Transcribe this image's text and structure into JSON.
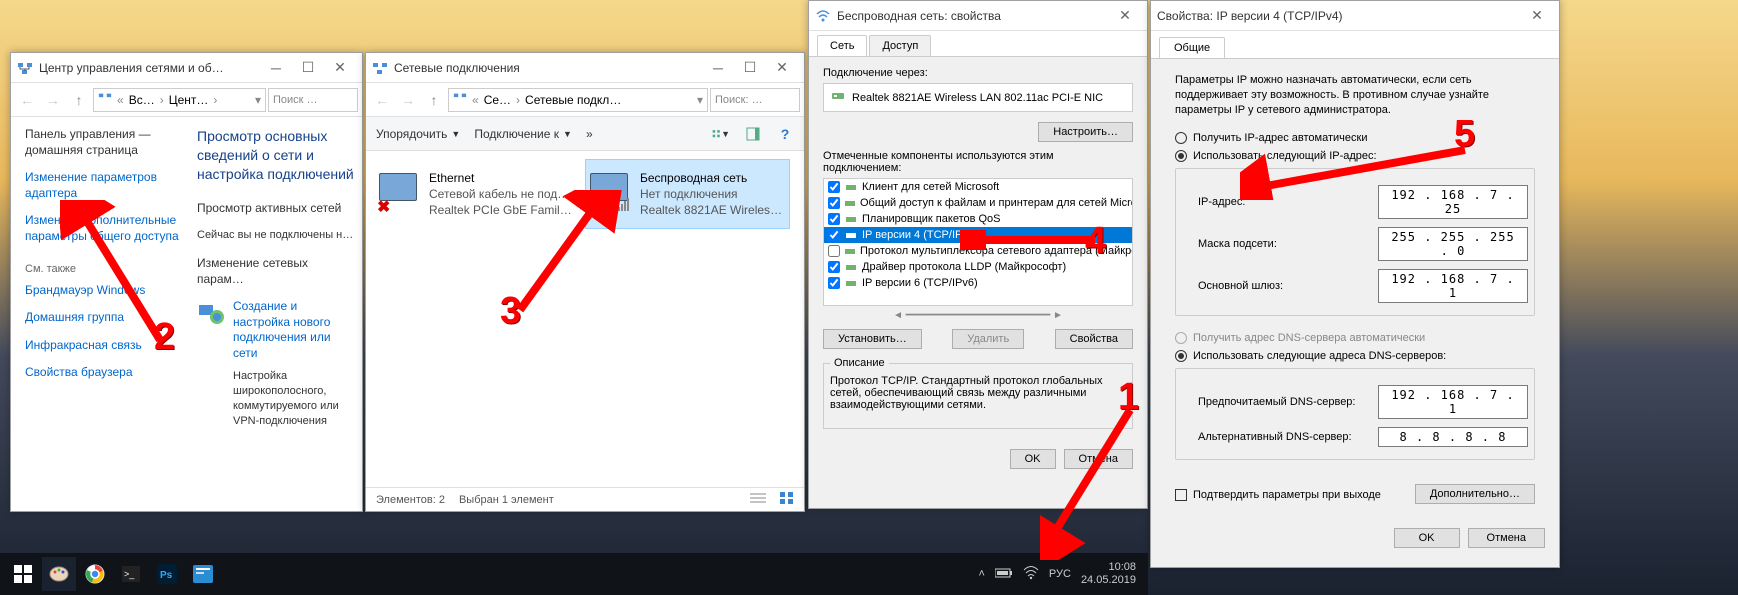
{
  "w1": {
    "title": "Центр управления сетями и об…",
    "crumb1": "Вс…",
    "crumb2": "Цент…",
    "search": "Поиск …",
    "side_home1": "Панель управления —",
    "side_home2": "домашняя страница",
    "side_adapter1": "Изменение параметров",
    "side_adapter2": "адаптера",
    "side_sharing1": "Изменить дополнительные",
    "side_sharing2": "параметры общего доступа",
    "side_seealso": "См. также",
    "side_fw": "Брандмауэр Windows",
    "side_hg": "Домашняя группа",
    "side_ir": "Инфракрасная связь",
    "side_bp": "Свойства браузера",
    "main_h3": "Просмотр основных сведений о сети и настройка подключений",
    "main_act_hdr": "Просмотр активных сетей",
    "main_act_txt": "Сейчас вы не подключены н…",
    "main_chg_hdr": "Изменение сетевых парам…",
    "main_link": "Создание и настройка нового подключения или сети",
    "main_plain": "Настройка широкополосного, коммутируемого или VPN-подключения"
  },
  "w2": {
    "title": "Сетевые подключения",
    "crumb1": "Се…",
    "crumb2": "Сетевые подкл…",
    "search": "Поиск: …",
    "tb_org": "Упорядочить",
    "tb_conn": "Подключение к",
    "eth_name": "Ethernet",
    "eth_state": "Сетевой кабель не подк…",
    "eth_adapter": "Realtek PCIe GbE Family …",
    "wifi_name": "Беспроводная сеть",
    "wifi_state": "Нет подключения",
    "wifi_adapter": "Realtek 8821AE Wireless …",
    "status1": "Элементов: 2",
    "status2": "Выбран 1 элемент"
  },
  "w3": {
    "title": "Беспроводная сеть: свойства",
    "tab1": "Сеть",
    "tab2": "Доступ",
    "conn_via": "Подключение через:",
    "adapter": "Realtek 8821AE Wireless LAN 802.11ac PCI-E NIC",
    "btn_conf": "Настроить…",
    "comps_lbl": "Отмеченные компоненты используются этим подключением:",
    "comps": [
      {
        "chk": true,
        "label": "Клиент для сетей Microsoft"
      },
      {
        "chk": true,
        "label": "Общий доступ к файлам и принтерам для сетей Micro"
      },
      {
        "chk": true,
        "label": "Планировщик пакетов QoS"
      },
      {
        "chk": true,
        "label": "IP версии 4 (TCP/IPv4)",
        "sel": true
      },
      {
        "chk": false,
        "label": "Протокол мультиплексора сетевого адаптера (Майкро"
      },
      {
        "chk": true,
        "label": "Драйвер протокола LLDP (Майкрософт)"
      },
      {
        "chk": true,
        "label": "IP версии 6 (TCP/IPv6)"
      }
    ],
    "btn_inst": "Установить…",
    "btn_del": "Удалить",
    "btn_prop": "Свойства",
    "desc_h": "Описание",
    "desc": "Протокол TCP/IP. Стандартный протокол глобальных сетей, обеспечивающий связь между различными взаимодействующими сетями.",
    "ok": "OK",
    "cancel": "Отмена"
  },
  "w4": {
    "title": "Свойства: IP версии 4 (TCP/IPv4)",
    "tab1": "Общие",
    "intro": "Параметры IP можно назначать автоматически, если сеть поддерживает эту возможность. В противном случае узнайте параметры IP у сетевого администратора.",
    "r_auto_ip": "Получить IP-адрес автоматически",
    "r_man_ip": "Использовать следующий IP-адрес:",
    "f_ip": "IP-адрес:",
    "v_ip": "192 . 168 .  7  . 25",
    "f_mask": "Маска подсети:",
    "v_mask": "255 . 255 . 255 .  0",
    "f_gw": "Основной шлюз:",
    "v_gw": "192 . 168 .  7  .  1",
    "r_auto_dns": "Получить адрес DNS-сервера автоматически",
    "r_man_dns": "Использовать следующие адреса DNS-серверов:",
    "f_dns1": "Предпочитаемый DNS-сервер:",
    "v_dns1": "192 . 168 .  7  .  1",
    "f_dns2": "Альтернативный DNS-сервер:",
    "v_dns2": " 8  .  8  .  8  .  8",
    "chk_valid": "Подтвердить параметры при выходе",
    "btn_adv": "Дополнительно…",
    "ok": "OK",
    "cancel": "Отмена"
  },
  "tb": {
    "lang": "РУС",
    "time": "10:08",
    "date": "24.05.2019"
  },
  "nums": {
    "n1": "1",
    "n2": "2",
    "n3": "3",
    "n4": "4",
    "n5": "5"
  }
}
